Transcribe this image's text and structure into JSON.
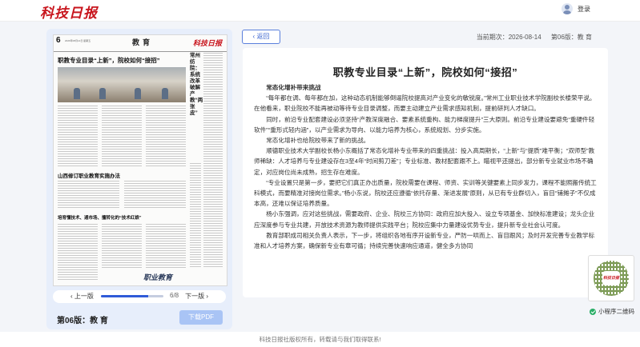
{
  "header": {
    "logo": "科技日报",
    "login": "登录"
  },
  "paper": {
    "page_number": "6",
    "date_line": "2026年08月14日 星期五",
    "section": "教育",
    "masthead": "科技日报",
    "headline": "职教专业目录“上新”，院校如何“接招”",
    "side_headline": "常州纺院：系统改革破解产教“两张皮”",
    "sub1": "山西修订职业教育实施办法",
    "sub2": "培育懂技术、通市场、擅转化的“技术红娘”",
    "bottom_logo": "职业教育"
  },
  "pager": {
    "prev": "上一版",
    "next": "下一版",
    "current": 6,
    "total": 8,
    "count_text": "6/8"
  },
  "edition": "第06版：教 育",
  "download": "下载PDF",
  "back": "返回",
  "meta": {
    "period_label": "当前期次：2026-08-14",
    "edition_label": "第06版：教 育"
  },
  "article": {
    "title": "职教专业目录“上新”，院校如何“接招”",
    "paragraphs": [
      {
        "type": "h",
        "text": "常态化增补带来挑战"
      },
      {
        "type": "p",
        "text": "“每年都在调、每年都在加，这种动态机制能够倒逼院校提高对产业变化的敏锐度。”常州工业职业技术学院副校长楼荣平说。在他看来，职业院校不能再被动等待专业目录调整，而要主动建立产业需求感知机制，提前研判人才缺口。"
      },
      {
        "type": "p",
        "text": "同时，前沿专业配套建设必须坚持“产教深度融合、要素系统重构、能力梯度提升”三大原则。前沿专业建设要避免“重硬件轻软件”“重形式轻内涵”，以产业需求为导向、以能力培养为核心，系统规划、分步实施。"
      },
      {
        "type": "p",
        "text": "常态化增补也给院校带来了新的挑战。"
      },
      {
        "type": "p",
        "text": "顺德职业技术大学副校长杨小东概括了常态化增补专业带来的四重挑战：投入高周期长，“上新”与“提质”难平衡；“双师型”教师稀缺：人才培养与专业建设存在3至4年“时间剪刀差”；专业标准、教材配套跟不上。瞄视平还提出，部分新专业就业市场不确定，对应岗位尚未成熟，招生存在难度。"
      },
      {
        "type": "p",
        "text": "“专业设置只是第一步，要把它们真正办出质量，院校需要在课程、师资、实训等关键要素上同步发力，课程不能照搬传统工科模式，而要精准对接岗位需求。”杨小东说，院校还应遵循“依托存量、渐进发展”原则，从已有专业群切入，盲目“铺摊子”不仅成本高，还难以保证培养质量。"
      },
      {
        "type": "p",
        "text": "杨小东强调，应对这些挑战，需要政府、企业、院校三方协同：政府应加大投入、设立专项基金、加快标准建设；龙头企业应深度参与专业共建，开放技术资源为教师提供实践平台；院校应集中力量建设优势专业，提升新专业社会认可度。"
      },
      {
        "type": "p",
        "text": "教育部职成司相关负责人表示，下一步，将组织各地有序开设新专业，严防一哄而上、盲目跟风；及时开发完善专业教学标准和人才培养方案，确保新专业有章可循；持续完善快速响应通道，健全多方协同"
      }
    ]
  },
  "qr": {
    "label": "小程序二维码",
    "mark": "科技日报"
  },
  "footer": "科技日报社版权所有，转载请与我们取得联系!"
}
